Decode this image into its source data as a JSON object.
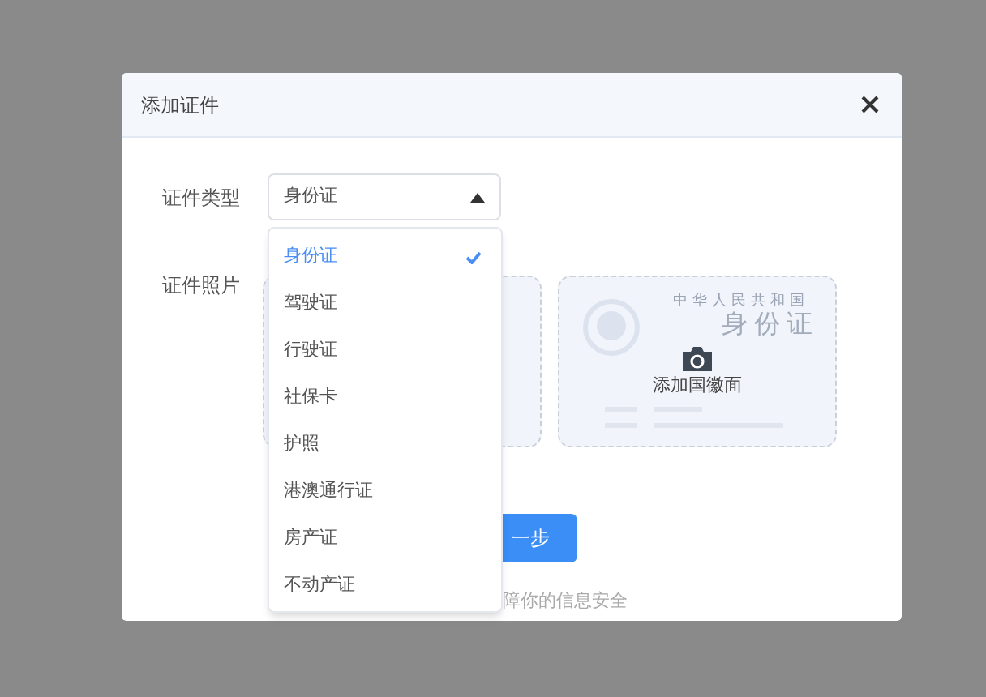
{
  "dialog": {
    "title": "添加证件"
  },
  "type_field": {
    "label": "证件类型",
    "value": "身份证",
    "expanded": true,
    "options": [
      {
        "label": "身份证",
        "selected": true
      },
      {
        "label": "驾驶证",
        "selected": false
      },
      {
        "label": "行驶证",
        "selected": false
      },
      {
        "label": "社保卡",
        "selected": false
      },
      {
        "label": "护照",
        "selected": false
      },
      {
        "label": "港澳通行证",
        "selected": false
      },
      {
        "label": "房产证",
        "selected": false
      },
      {
        "label": "不动产证",
        "selected": false
      }
    ]
  },
  "photo_field": {
    "label": "证件照片",
    "cards": [
      {
        "kind": "front"
      },
      {
        "kind": "back",
        "watermark_title": "中华人民共和国",
        "watermark_name": "身份证",
        "action": "添加国徽面"
      }
    ]
  },
  "next_button": "一步",
  "hint": "障你的信息安全"
}
